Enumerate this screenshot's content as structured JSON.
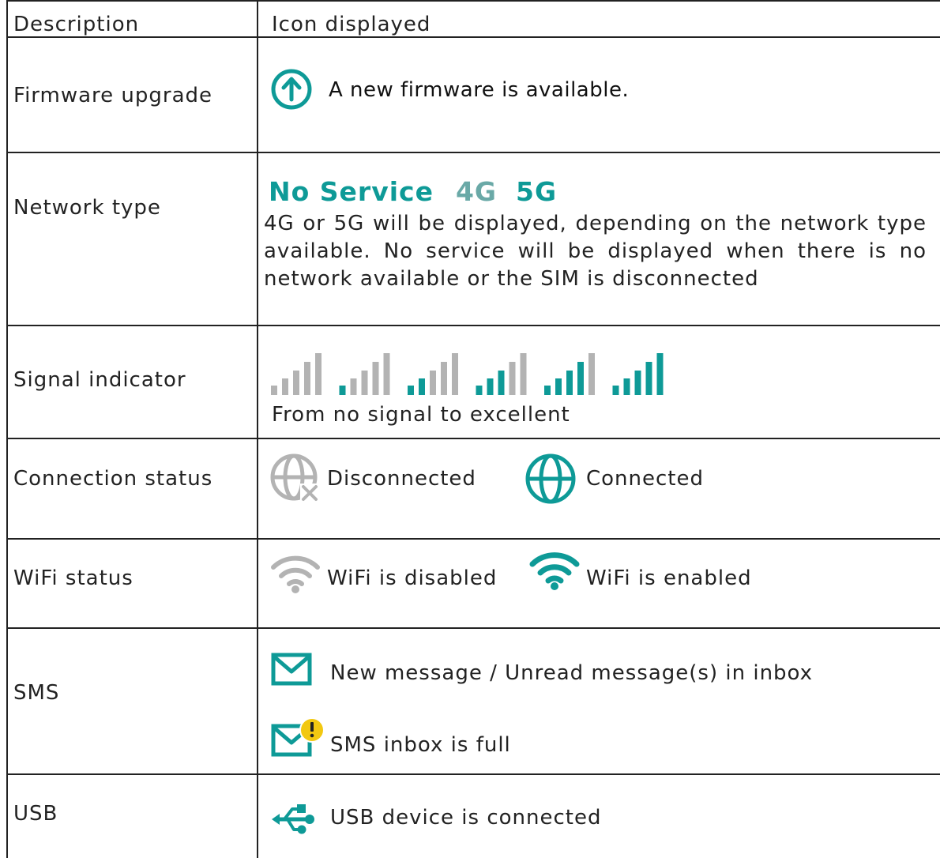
{
  "table": {
    "header": {
      "description": "Description",
      "icon": "Icon displayed"
    },
    "rows": {
      "firmware": {
        "label": "Firmware upgrade",
        "text": "A new firmware is available."
      },
      "network": {
        "label": "Network type",
        "badges": {
          "no_service": "No Service",
          "g4": "4G",
          "g5": "5G"
        },
        "text": "4G or 5G will be displayed, depending on the network type available. No service will be displayed when there is no network available or the SIM is disconnected"
      },
      "signal": {
        "label": "Signal indicator",
        "text": "From no signal to excellent",
        "levels": [
          0,
          1,
          2,
          3,
          4,
          5
        ]
      },
      "connection": {
        "label": "Connection status",
        "disconnected": "Disconnected",
        "connected": "Connected"
      },
      "wifi": {
        "label": "WiFi status",
        "disabled": "WiFi is disabled",
        "enabled": "WiFi is enabled"
      },
      "sms": {
        "label": "SMS",
        "new_message": "New message / Unread message(s) in inbox",
        "inbox_full": "SMS inbox is full"
      },
      "usb": {
        "label": "USB",
        "text": "USB device is connected"
      }
    }
  },
  "colors": {
    "active": "#0e9a97",
    "inactive": "#b3b3b3",
    "warning": "#f2c811",
    "border": "#222222"
  }
}
